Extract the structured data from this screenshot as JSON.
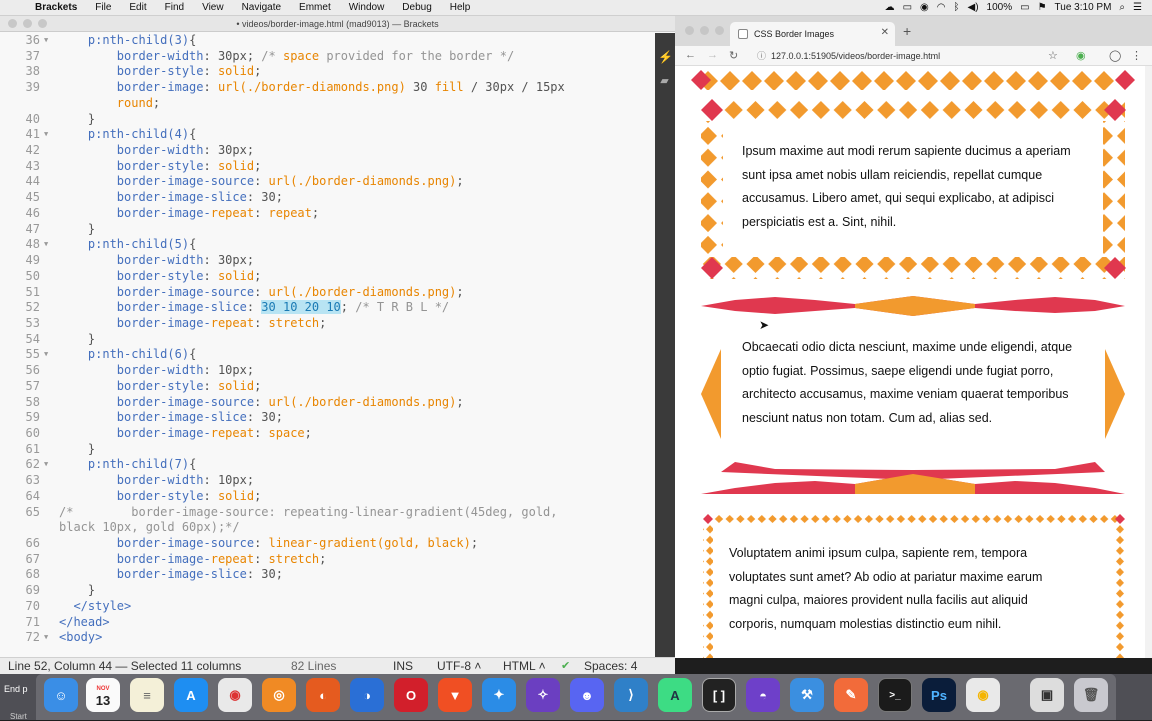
{
  "menubar": {
    "app": "Brackets",
    "items": [
      "File",
      "Edit",
      "Find",
      "View",
      "Navigate",
      "Emmet",
      "Window",
      "Debug",
      "Help"
    ],
    "battery": "100%",
    "clock": "Tue 3:10 PM"
  },
  "editor": {
    "window_title": "• videos/border-image.html (mad9013) — Brackets",
    "lines": [
      {
        "n": "36",
        "fold": "▼",
        "text": "    p:nth-child(3){"
      },
      {
        "n": "37",
        "fold": "",
        "text": "        border-width: 30px; /* space provided for the border */"
      },
      {
        "n": "38",
        "fold": "",
        "text": "        border-style: solid;"
      },
      {
        "n": "39",
        "fold": "",
        "text": "        border-image: url(./border-diamonds.png) 30 fill / 30px / 15px"
      },
      {
        "n": "",
        "fold": "",
        "text": "        round;"
      },
      {
        "n": "40",
        "fold": "",
        "text": "    }"
      },
      {
        "n": "41",
        "fold": "▼",
        "text": "    p:nth-child(4){"
      },
      {
        "n": "42",
        "fold": "",
        "text": "        border-width: 30px;"
      },
      {
        "n": "43",
        "fold": "",
        "text": "        border-style: solid;"
      },
      {
        "n": "44",
        "fold": "",
        "text": "        border-image-source: url(./border-diamonds.png);"
      },
      {
        "n": "45",
        "fold": "",
        "text": "        border-image-slice: 30;"
      },
      {
        "n": "46",
        "fold": "",
        "text": "        border-image-repeat: repeat;"
      },
      {
        "n": "47",
        "fold": "",
        "text": "    }"
      },
      {
        "n": "48",
        "fold": "▼",
        "text": "    p:nth-child(5){"
      },
      {
        "n": "49",
        "fold": "",
        "text": "        border-width: 30px;"
      },
      {
        "n": "50",
        "fold": "",
        "text": "        border-style: solid;"
      },
      {
        "n": "51",
        "fold": "",
        "text": "        border-image-source: url(./border-diamonds.png);"
      },
      {
        "n": "52",
        "fold": "",
        "text": "        border-image-slice: 30 10 20 10; /* T R B L */"
      },
      {
        "n": "53",
        "fold": "",
        "text": "        border-image-repeat: stretch;"
      },
      {
        "n": "54",
        "fold": "",
        "text": "    }"
      },
      {
        "n": "55",
        "fold": "▼",
        "text": "    p:nth-child(6){"
      },
      {
        "n": "56",
        "fold": "",
        "text": "        border-width: 10px;"
      },
      {
        "n": "57",
        "fold": "",
        "text": "        border-style: solid;"
      },
      {
        "n": "58",
        "fold": "",
        "text": "        border-image-source: url(./border-diamonds.png);"
      },
      {
        "n": "59",
        "fold": "",
        "text": "        border-image-slice: 30;"
      },
      {
        "n": "60",
        "fold": "",
        "text": "        border-image-repeat: space;"
      },
      {
        "n": "61",
        "fold": "",
        "text": "    }"
      },
      {
        "n": "62",
        "fold": "▼",
        "text": "    p:nth-child(7){"
      },
      {
        "n": "63",
        "fold": "",
        "text": "        border-width: 10px;"
      },
      {
        "n": "64",
        "fold": "",
        "text": "        border-style: solid;"
      },
      {
        "n": "65",
        "fold": "",
        "text": "/*        border-image-source: repeating-linear-gradient(45deg, gold,"
      },
      {
        "n": "",
        "fold": "",
        "text": "black 10px, gold 60px);*/"
      },
      {
        "n": "66",
        "fold": "",
        "text": "        border-image-source: linear-gradient(gold, black);"
      },
      {
        "n": "67",
        "fold": "",
        "text": "        border-image-repeat: stretch;"
      },
      {
        "n": "68",
        "fold": "",
        "text": "        border-image-slice: 30;"
      },
      {
        "n": "69",
        "fold": "",
        "text": "    }"
      },
      {
        "n": "70",
        "fold": "",
        "text": "  </style>"
      },
      {
        "n": "71",
        "fold": "",
        "text": "</head>"
      },
      {
        "n": "72",
        "fold": "▼",
        "text": "<body>"
      }
    ],
    "selection": "30 10 20 10",
    "status": {
      "cursor": "Line 52, Column 44 — Selected 11 columns",
      "lines": "82 Lines",
      "mode": "INS",
      "encoding": "UTF-8",
      "language": "HTML",
      "spaces": "Spaces: 4"
    }
  },
  "browser": {
    "tab_title": "CSS Border Images",
    "url": "127.0.0.1:51905/videos/border-image.html",
    "paragraphs": [
      "Ipsum maxime aut modi rerum sapiente ducimus a aperiam sunt ipsa amet nobis ullam reiciendis, repellat cumque accusamus. Libero amet, qui sequi explicabo, at adipisci perspiciatis est a. Sint, nihil.",
      "Obcaecati odio dicta nesciunt, maxime unde eligendi, atque optio fugiat. Possimus, saepe eligendi unde fugiat porro, architecto accusamus, maxime veniam quaerat temporibus nesciunt natus non totam. Cum ad, alias sed.",
      "Voluptatem animi ipsum culpa, sapiente rem, tempora voluptates sunt amet? Ab odio at pariatur maxime earum magni culpa, maiores provident nulla facilis aut aliquid corporis, numquam molestias distinctio eum nihil."
    ],
    "colors": {
      "red": "#e0384f",
      "orange": "#f29a2e"
    }
  },
  "dock": {
    "end_label": "End p",
    "start_label": "Start",
    "calendar_day": "13",
    "calendar_month": "NOV",
    "apps": [
      "finder-icon",
      "calendar-icon",
      "notes-icon",
      "app-store-icon",
      "chrome-icon",
      "ubuntu-icon",
      "firefox-icon",
      "firefox-dev-icon",
      "opera-icon",
      "brave-icon",
      "safari-icon",
      "safari-preview-icon",
      "discord-icon",
      "vscode-icon",
      "android-studio-icon",
      "brackets-icon",
      "github-icon",
      "xcode-icon",
      "postman-icon",
      "terminal-icon",
      "photoshop-icon",
      "chrome-canary-icon",
      "screenshot-icon",
      "trash-icon"
    ]
  }
}
